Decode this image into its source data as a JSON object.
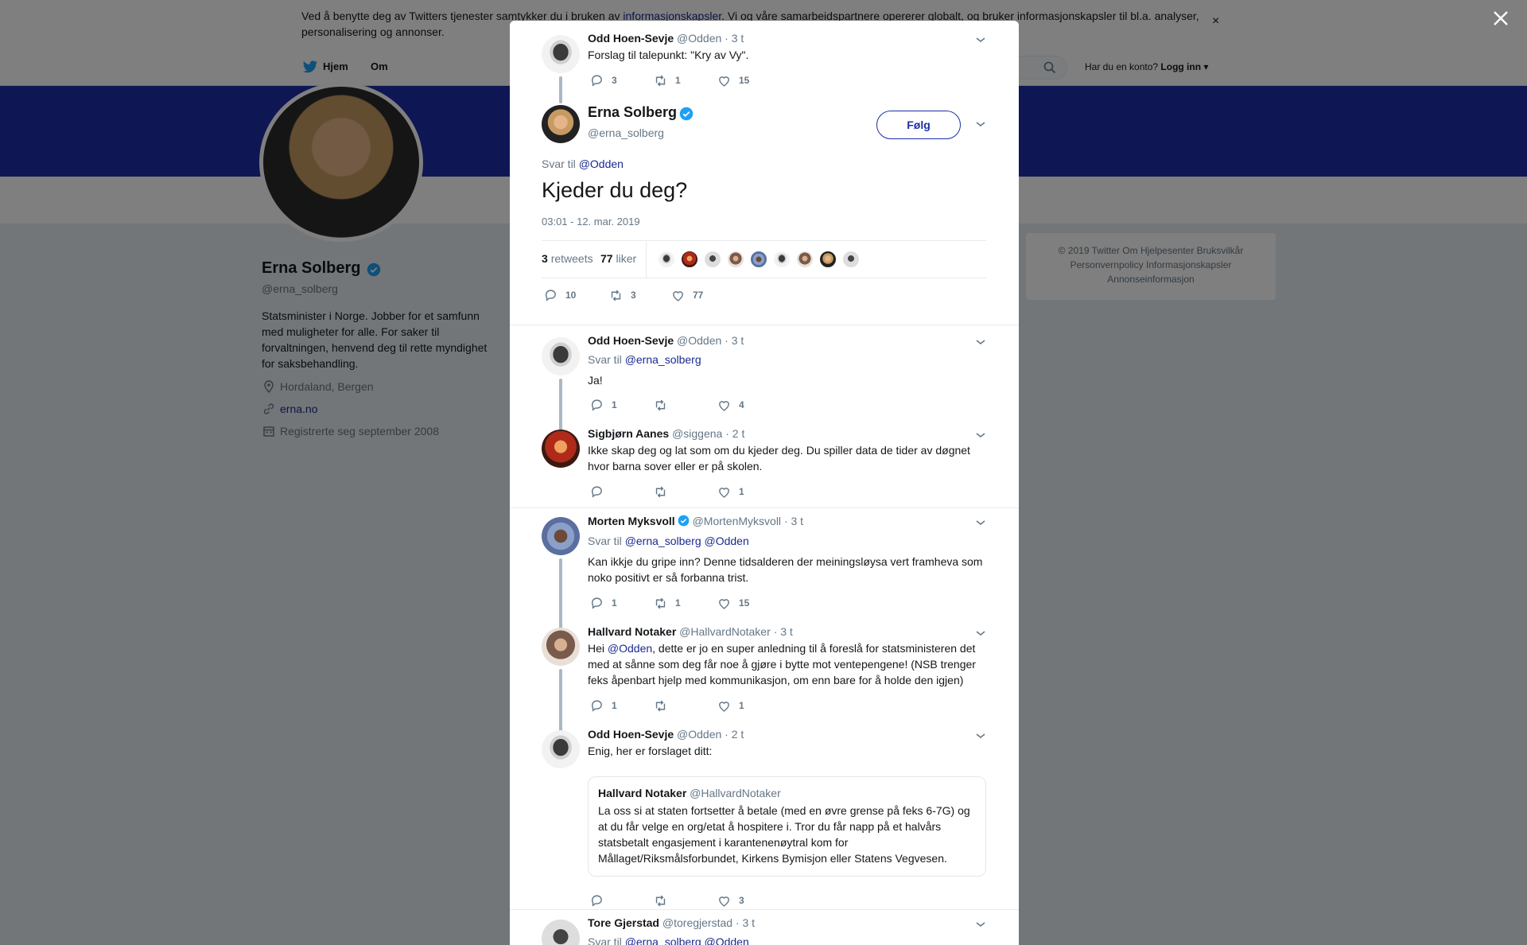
{
  "cookie_banner": {
    "text_before": "Ved å benytte deg av Twitters tjenester samtykker du i bruken av ",
    "link": "informasjonskapsler",
    "text_after": ". Vi og våre samarbeidspartnere opererer globalt, og bruker informasjonskapsler til bl.a. analyser, personalisering og annonser.",
    "close": "×"
  },
  "nav": {
    "home": "Hjem",
    "about": "Om",
    "account_question": "Har du en konto?",
    "login": "Logg inn"
  },
  "profile": {
    "name": "Erna Solberg",
    "handle": "@erna_solberg",
    "bio": "Statsminister i Norge. Jobber for et samfunn med muligheter for alle. For saker til forvaltningen, henvend deg til rette myndighet for saksbehandling.",
    "location": "Hordaland, Bergen",
    "website": "erna.no",
    "joined": "Registrerte seg september 2008"
  },
  "footer": {
    "line1": "© 2019 Twitter   Om   Hjelpesenter   Bruksvilkår",
    "line2": "Personvernpolicy   Informasjonskapsler",
    "line3": "Annonseinformasjon"
  },
  "modal": {
    "parent": {
      "name": "Odd Hoen-Sevje",
      "handle": "@Odden",
      "time": "· 3 t",
      "text": "Forslag til talepunkt: \"Kry av Vy\".",
      "replies": "3",
      "retweets": "1",
      "likes": "15"
    },
    "main": {
      "name": "Erna Solberg",
      "handle": "@erna_solberg",
      "follow": "Følg",
      "reply_prefix": "Svar til",
      "reply_to": "@Odden",
      "text": "Kjeder du deg?",
      "date": "03:01 - 12. mar. 2019",
      "retweets_count": "3",
      "retweets_label": "retweets",
      "likes_count": "77",
      "likes_label": "liker",
      "replies": "10",
      "retweets": "3",
      "likes": "77"
    },
    "replies": [
      {
        "name": "Odd Hoen-Sevje",
        "handle": "@Odden",
        "time": "· 3 t",
        "reply_prefix": "Svar til",
        "reply_to": "@erna_solberg",
        "text": "Ja!",
        "replies": "1",
        "retweets": "",
        "likes": "4"
      },
      {
        "name": "Sigbjørn Aanes",
        "handle": "@siggena",
        "time": "· 2 t",
        "text": "Ikke skap deg og lat som om du kjeder deg. Du spiller data de tider av døgnet hvor barna sover eller er på skolen.",
        "replies": "",
        "retweets": "",
        "likes": "1"
      },
      {
        "name": "Morten Myksvoll",
        "handle": "@MortenMyksvoll",
        "time": "· 3 t",
        "reply_prefix": "Svar til",
        "reply_to": "@erna_solberg @Odden",
        "text": "Kan ikkje du gripe inn? Denne tidsalderen der meiningsløysa vert framheva som noko positivt er så forbanna trist.",
        "replies": "1",
        "retweets": "1",
        "likes": "15"
      },
      {
        "name": "Hallvard Notaker",
        "handle": "@HallvardNotaker",
        "time": "· 3 t",
        "text_before": "Hei ",
        "mention": "@Odden",
        "text_after": ", dette er jo en super anledning til å foreslå for statsministeren det med at sånne som deg får noe å gjøre i bytte mot ventepengene! (NSB trenger feks åpenbart hjelp med kommunikasjon, om enn bare for å holde den igjen)",
        "replies": "1",
        "retweets": "",
        "likes": "1"
      },
      {
        "name": "Odd Hoen-Sevje",
        "handle": "@Odden",
        "time": "· 2 t",
        "text": "Enig, her er forslaget ditt:",
        "quote_name": "Hallvard Notaker",
        "quote_handle": "@HallvardNotaker",
        "quote_text": "La oss si at staten fortsetter å betale (med en øvre grense på feks 6-7G) og at du får velge en org/etat å hospitere i. Tror du får napp på et halvårs statsbetalt engasjement i karantenenøytral kom for Mållaget/Riksmålsforbundet, Kirkens Bymisjon eller Statens Vegvesen.",
        "replies": "",
        "retweets": "",
        "likes": "3"
      },
      {
        "name": "Tore Gjerstad",
        "handle": "@toregjerstad",
        "time": "· 3 t",
        "reply_prefix": "Svar til",
        "reply_to": "@erna_solberg @Odden"
      }
    ]
  },
  "colors": {
    "brand": "#1c2fa8",
    "link": "#1b2a8f",
    "verified": "#1da1f2",
    "muted": "#657786"
  }
}
